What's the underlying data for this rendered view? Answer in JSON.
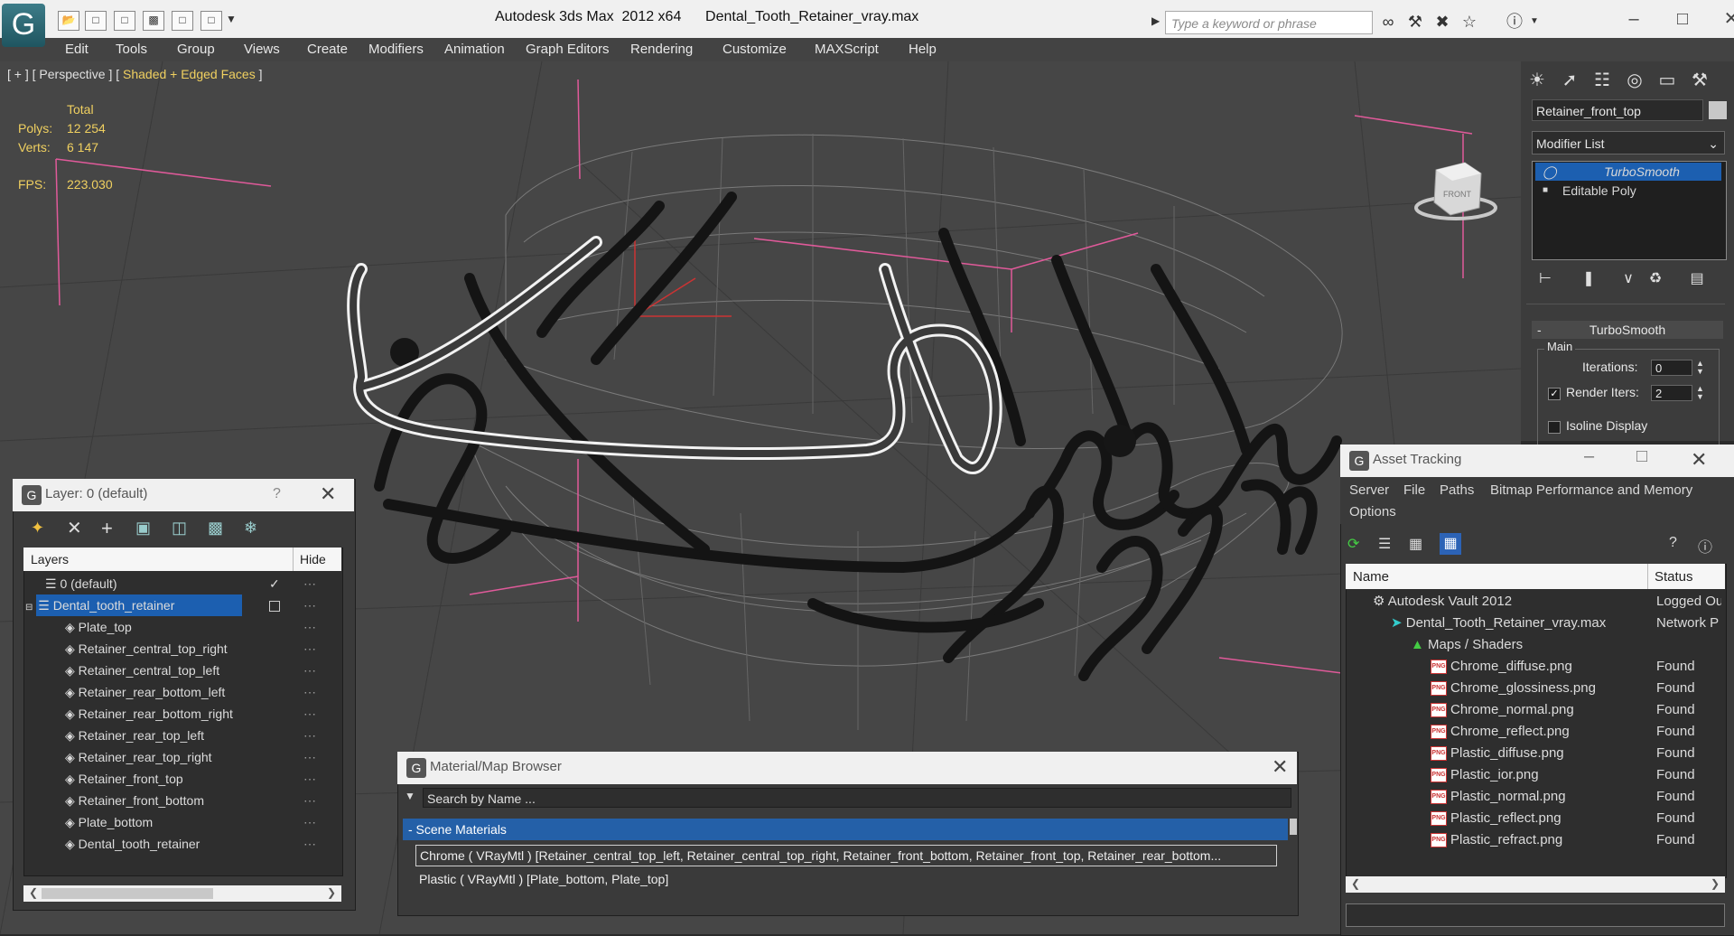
{
  "app": {
    "title": "Autodesk 3ds Max  2012 x64      Dental_Tooth_Retainer_vray.max",
    "search_placeholder": "Type a keyword or phrase",
    "logo": "G"
  },
  "menu": [
    "Edit",
    "Tools",
    "Group",
    "Views",
    "Create",
    "Modifiers",
    "Animation",
    "Graph Editors",
    "Rendering",
    "Customize",
    "MAXScript",
    "Help"
  ],
  "viewport": {
    "label_prefix": "[ + ] [ Perspective ] [ ",
    "label_mode": "Shaded + Edged Faces",
    "label_suffix": " ]",
    "stats": {
      "total_label": "Total",
      "polys_label": "Polys:",
      "polys_value": "12 254",
      "verts_label": "Verts:",
      "verts_value": "6 147",
      "fps_label": "FPS:",
      "fps_value": "223.030"
    },
    "viewcube_label": "FRONT"
  },
  "command_panel": {
    "object_name": "Retainer_front_top",
    "modifier_list": "Modifier List",
    "stack": [
      "TurboSmooth",
      "Editable Poly"
    ],
    "rollout_title": "TurboSmooth",
    "group_main": "Main",
    "iterations_label": "Iterations:",
    "iterations_value": "0",
    "render_iters_label": "Render Iters:",
    "render_iters_value": "2",
    "isoline_label": "Isoline Display"
  },
  "layer_dialog": {
    "title": "Layer: 0 (default)",
    "help": "?",
    "col_layers": "Layers",
    "col_hide": "Hide",
    "rows": [
      {
        "name": "0 (default)",
        "indent": 1
      },
      {
        "name": "Dental_tooth_retainer",
        "indent": 1,
        "selected": true
      },
      {
        "name": "Plate_top",
        "indent": 2
      },
      {
        "name": "Retainer_central_top_right",
        "indent": 2
      },
      {
        "name": "Retainer_central_top_left",
        "indent": 2
      },
      {
        "name": "Retainer_rear_bottom_left",
        "indent": 2
      },
      {
        "name": "Retainer_rear_bottom_right",
        "indent": 2
      },
      {
        "name": "Retainer_rear_top_left",
        "indent": 2
      },
      {
        "name": "Retainer_rear_top_right",
        "indent": 2
      },
      {
        "name": "Retainer_front_top",
        "indent": 2
      },
      {
        "name": "Retainer_front_bottom",
        "indent": 2
      },
      {
        "name": "Plate_bottom",
        "indent": 2
      },
      {
        "name": "Dental_tooth_retainer",
        "indent": 2
      }
    ]
  },
  "material_browser": {
    "title": "Material/Map Browser",
    "search_placeholder": "Search by Name ...",
    "group": "- Scene Materials",
    "items": [
      "Chrome ( VRayMtl ) [Retainer_central_top_left, Retainer_central_top_right, Retainer_front_bottom, Retainer_front_top, Retainer_rear_bottom...",
      "Plastic ( VRayMtl ) [Plate_bottom, Plate_top]"
    ]
  },
  "asset_tracking": {
    "title": "Asset Tracking",
    "menus": [
      "Server",
      "File",
      "Paths",
      "Bitmap Performance and Memory"
    ],
    "options": "Options",
    "col_name": "Name",
    "col_status": "Status",
    "rows": [
      {
        "name": "Autodesk Vault 2012",
        "status": "Logged Ou",
        "indent": 0
      },
      {
        "name": "Dental_Tooth_Retainer_vray.max",
        "status": "Network P",
        "indent": 1
      },
      {
        "name": "Maps / Shaders",
        "status": "",
        "indent": 2
      },
      {
        "name": "Chrome_diffuse.png",
        "status": "Found",
        "indent": 3
      },
      {
        "name": "Chrome_glossiness.png",
        "status": "Found",
        "indent": 3
      },
      {
        "name": "Chrome_normal.png",
        "status": "Found",
        "indent": 3
      },
      {
        "name": "Chrome_reflect.png",
        "status": "Found",
        "indent": 3
      },
      {
        "name": "Plastic_diffuse.png",
        "status": "Found",
        "indent": 3
      },
      {
        "name": "Plastic_ior.png",
        "status": "Found",
        "indent": 3
      },
      {
        "name": "Plastic_normal.png",
        "status": "Found",
        "indent": 3
      },
      {
        "name": "Plastic_reflect.png",
        "status": "Found",
        "indent": 3
      },
      {
        "name": "Plastic_refract.png",
        "status": "Found",
        "indent": 3
      }
    ]
  },
  "colors": {
    "accent_selected": "#1c5fb0",
    "stat_yellow": "#f0d060",
    "bbox_pink": "#e05a9a"
  }
}
